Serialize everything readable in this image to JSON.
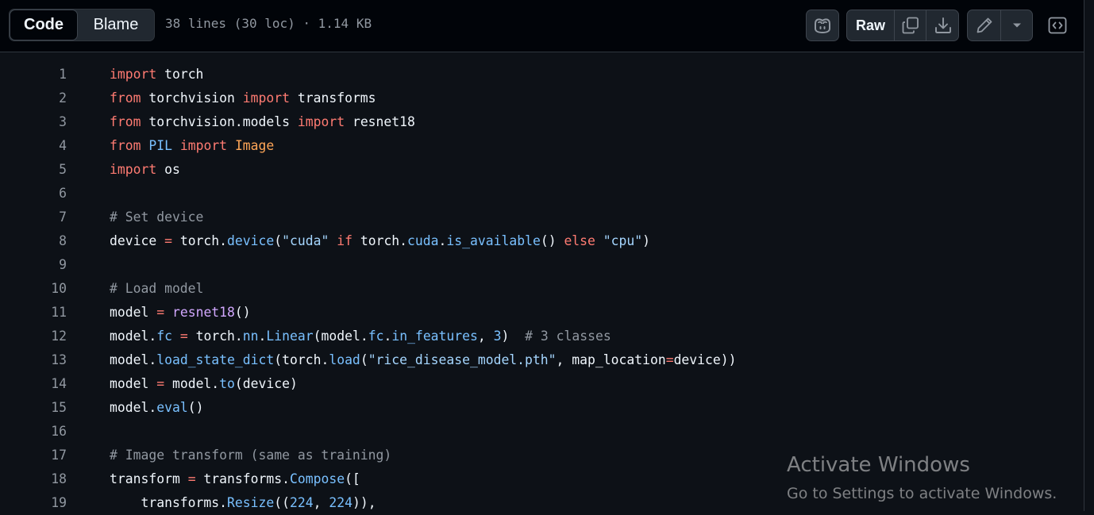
{
  "toolbar": {
    "code_tab": "Code",
    "blame_tab": "Blame",
    "file_info": "38 lines (30 loc) · 1.14 KB",
    "raw_label": "Raw",
    "icons": [
      "copilot-icon",
      "copy-icon",
      "download-icon",
      "pencil-icon",
      "triangle-down-icon",
      "code-square-icon"
    ]
  },
  "code": {
    "lines": [
      {
        "n": "1",
        "tokens": [
          [
            "kw",
            "import"
          ],
          [
            "t",
            " torch"
          ]
        ]
      },
      {
        "n": "2",
        "tokens": [
          [
            "kw",
            "from"
          ],
          [
            "t",
            " torchvision "
          ],
          [
            "kw",
            "import"
          ],
          [
            "t",
            " transforms"
          ]
        ]
      },
      {
        "n": "3",
        "tokens": [
          [
            "kw",
            "from"
          ],
          [
            "t",
            " torchvision.models "
          ],
          [
            "kw",
            "import"
          ],
          [
            "t",
            " resnet18"
          ]
        ]
      },
      {
        "n": "4",
        "tokens": [
          [
            "kw",
            "from"
          ],
          [
            "t",
            " "
          ],
          [
            "pr",
            "PIL"
          ],
          [
            "t",
            " "
          ],
          [
            "kw",
            "import"
          ],
          [
            "t",
            " "
          ],
          [
            "cl",
            "Image"
          ]
        ]
      },
      {
        "n": "5",
        "tokens": [
          [
            "kw",
            "import"
          ],
          [
            "t",
            " os"
          ]
        ]
      },
      {
        "n": "6",
        "tokens": []
      },
      {
        "n": "7",
        "tokens": [
          [
            "cm",
            "# Set device"
          ]
        ]
      },
      {
        "n": "8",
        "tokens": [
          [
            "t",
            "device "
          ],
          [
            "kw",
            "="
          ],
          [
            "t",
            " torch."
          ],
          [
            "pr",
            "device"
          ],
          [
            "t",
            "("
          ],
          [
            "st",
            "\"cuda\""
          ],
          [
            "t",
            " "
          ],
          [
            "kw",
            "if"
          ],
          [
            "t",
            " torch."
          ],
          [
            "pr",
            "cuda"
          ],
          [
            "t",
            "."
          ],
          [
            "pr",
            "is_available"
          ],
          [
            "t",
            "() "
          ],
          [
            "kw",
            "else"
          ],
          [
            "t",
            " "
          ],
          [
            "st",
            "\"cpu\""
          ],
          [
            "t",
            ")"
          ]
        ]
      },
      {
        "n": "9",
        "tokens": []
      },
      {
        "n": "10",
        "tokens": [
          [
            "cm",
            "# Load model"
          ]
        ]
      },
      {
        "n": "11",
        "tokens": [
          [
            "t",
            "model "
          ],
          [
            "kw",
            "="
          ],
          [
            "t",
            " "
          ],
          [
            "fn",
            "resnet18"
          ],
          [
            "t",
            "()"
          ]
        ]
      },
      {
        "n": "12",
        "tokens": [
          [
            "t",
            "model."
          ],
          [
            "pr",
            "fc"
          ],
          [
            "t",
            " "
          ],
          [
            "kw",
            "="
          ],
          [
            "t",
            " torch."
          ],
          [
            "pr",
            "nn"
          ],
          [
            "t",
            "."
          ],
          [
            "pr",
            "Linear"
          ],
          [
            "t",
            "(model."
          ],
          [
            "pr",
            "fc"
          ],
          [
            "t",
            "."
          ],
          [
            "pr",
            "in_features"
          ],
          [
            "t",
            ", "
          ],
          [
            "pr",
            "3"
          ],
          [
            "t",
            ")  "
          ],
          [
            "cm",
            "# 3 classes"
          ]
        ]
      },
      {
        "n": "13",
        "tokens": [
          [
            "t",
            "model."
          ],
          [
            "pr",
            "load_state_dict"
          ],
          [
            "t",
            "(torch."
          ],
          [
            "pr",
            "load"
          ],
          [
            "t",
            "("
          ],
          [
            "st",
            "\"rice_disease_model.pth\""
          ],
          [
            "t",
            ", map_location"
          ],
          [
            "kw",
            "="
          ],
          [
            "t",
            "device))"
          ]
        ]
      },
      {
        "n": "14",
        "tokens": [
          [
            "t",
            "model "
          ],
          [
            "kw",
            "="
          ],
          [
            "t",
            " model."
          ],
          [
            "pr",
            "to"
          ],
          [
            "t",
            "(device)"
          ]
        ]
      },
      {
        "n": "15",
        "tokens": [
          [
            "t",
            "model."
          ],
          [
            "pr",
            "eval"
          ],
          [
            "t",
            "()"
          ]
        ]
      },
      {
        "n": "16",
        "tokens": []
      },
      {
        "n": "17",
        "tokens": [
          [
            "cm",
            "# Image transform (same as training)"
          ]
        ]
      },
      {
        "n": "18",
        "tokens": [
          [
            "t",
            "transform "
          ],
          [
            "kw",
            "="
          ],
          [
            "t",
            " transforms."
          ],
          [
            "pr",
            "Compose"
          ],
          [
            "t",
            "(["
          ]
        ]
      },
      {
        "n": "19",
        "tokens": [
          [
            "t",
            "    transforms."
          ],
          [
            "pr",
            "Resize"
          ],
          [
            "t",
            "(("
          ],
          [
            "pr",
            "224"
          ],
          [
            "t",
            ", "
          ],
          [
            "pr",
            "224"
          ],
          [
            "t",
            ")),"
          ]
        ]
      }
    ]
  },
  "watermark": {
    "title": "Activate Windows",
    "subtitle": "Go to Settings to activate Windows."
  }
}
